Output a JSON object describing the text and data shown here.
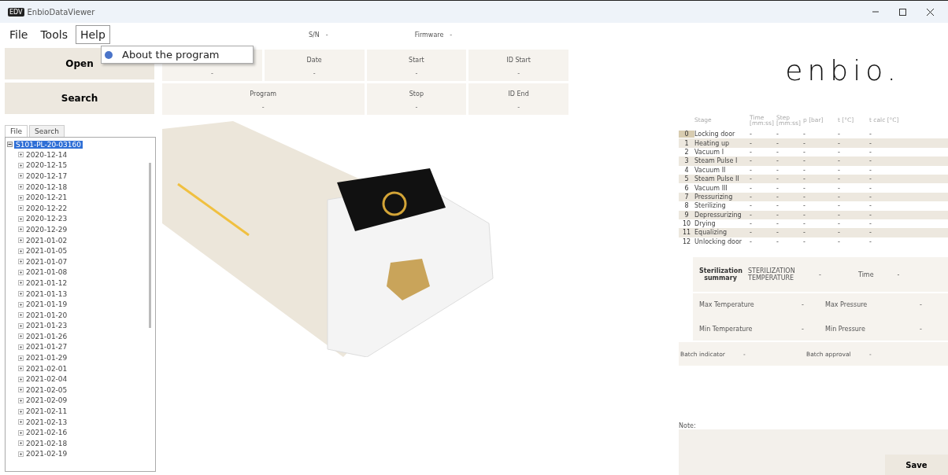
{
  "window": {
    "title": "EnbioDataViewer",
    "app_badge": "EDV"
  },
  "menu": [
    {
      "label": "File",
      "selected": false
    },
    {
      "label": "Tools",
      "selected": false
    },
    {
      "label": "Help",
      "selected": true
    }
  ],
  "dropdown": {
    "items": [
      "About the program"
    ]
  },
  "header_fields": [
    {
      "label": "S/N",
      "value": "-"
    },
    {
      "label": "Firmware",
      "value": "-"
    }
  ],
  "actions": [
    "Open",
    "Search"
  ],
  "info_top": [
    {
      "value": "-"
    },
    {
      "label": "Date",
      "value": "-"
    },
    {
      "label": "Start",
      "value": "-"
    },
    {
      "label": "ID Start",
      "value": "-"
    }
  ],
  "info_bottom": [
    {
      "label": "Program",
      "value": "-"
    },
    {
      "label": "Stop",
      "value": "-"
    },
    {
      "label": "ID End",
      "value": "-"
    }
  ],
  "side_tabs": [
    {
      "label": "File",
      "selected": true
    },
    {
      "label": "Search",
      "selected": false
    }
  ],
  "tree": {
    "label": "S101-PL-20-03160",
    "expanded": true,
    "selected": true,
    "children": [
      {
        "label": "2020-12-14"
      },
      {
        "label": "2020-12-15"
      },
      {
        "label": "2020-12-17"
      },
      {
        "label": "2020-12-18"
      },
      {
        "label": "2020-12-21"
      },
      {
        "label": "2020-12-22"
      },
      {
        "label": "2020-12-23"
      },
      {
        "label": "2020-12-29"
      },
      {
        "label": "2021-01-02"
      },
      {
        "label": "2021-01-05"
      },
      {
        "label": "2021-01-07"
      },
      {
        "label": "2021-01-08"
      },
      {
        "label": "2021-01-12"
      },
      {
        "label": "2021-01-13"
      },
      {
        "label": "2021-01-19"
      },
      {
        "label": "2021-01-20"
      },
      {
        "label": "2021-01-23"
      },
      {
        "label": "2021-01-26"
      },
      {
        "label": "2021-01-27"
      },
      {
        "label": "2021-01-29"
      },
      {
        "label": "2021-02-01"
      },
      {
        "label": "2021-02-04"
      },
      {
        "label": "2021-02-05"
      },
      {
        "label": "2021-02-09"
      },
      {
        "label": "2021-02-11"
      },
      {
        "label": "2021-02-13"
      },
      {
        "label": "2021-02-16"
      },
      {
        "label": "2021-02-18"
      },
      {
        "label": "2021-02-19"
      }
    ]
  },
  "logo": "enbio.",
  "stages": {
    "columns": [
      "",
      "Stage",
      "Time [mm:ss]",
      "Step [mm:ss]",
      "p [bar]",
      "t [°C]",
      "t calc [°C]"
    ],
    "rows": [
      {
        "selected": true,
        "cells": [
          "0",
          "Locking door",
          "-",
          "-",
          "-",
          "-",
          "-"
        ]
      },
      {
        "selected": false,
        "cells": [
          "1",
          "Heating up",
          "-",
          "-",
          "-",
          "-",
          "-"
        ]
      },
      {
        "selected": false,
        "cells": [
          "2",
          "Vacuum I",
          "-",
          "-",
          "-",
          "-",
          "-"
        ]
      },
      {
        "selected": false,
        "cells": [
          "3",
          "Steam Pulse I",
          "-",
          "-",
          "-",
          "-",
          "-"
        ]
      },
      {
        "selected": false,
        "cells": [
          "4",
          "Vacuum II",
          "-",
          "-",
          "-",
          "-",
          "-"
        ]
      },
      {
        "selected": false,
        "cells": [
          "5",
          "Steam Pulse II",
          "-",
          "-",
          "-",
          "-",
          "-"
        ]
      },
      {
        "selected": false,
        "cells": [
          "6",
          "Vacuum III",
          "-",
          "-",
          "-",
          "-",
          "-"
        ]
      },
      {
        "selected": false,
        "cells": [
          "7",
          "Pressurizing",
          "-",
          "-",
          "-",
          "-",
          "-"
        ]
      },
      {
        "selected": false,
        "cells": [
          "8",
          "Sterilizing",
          "-",
          "-",
          "-",
          "-",
          "-"
        ]
      },
      {
        "selected": false,
        "cells": [
          "9",
          "Depressurizing",
          "-",
          "-",
          "-",
          "-",
          "-"
        ]
      },
      {
        "selected": false,
        "cells": [
          "10",
          "Drying",
          "-",
          "-",
          "-",
          "-",
          "-"
        ]
      },
      {
        "selected": false,
        "cells": [
          "11",
          "Equalizing",
          "-",
          "-",
          "-",
          "-",
          "-"
        ]
      },
      {
        "selected": false,
        "cells": [
          "12",
          "Unlocking door",
          "-",
          "-",
          "-",
          "-",
          "-"
        ]
      }
    ]
  },
  "summary": {
    "title": "Sterilization summary",
    "temp_label": "STERILIZATION TEMPERATURE",
    "temp_value": "-",
    "time_label": "Time",
    "time_value": "-",
    "stats": [
      {
        "label": "Max Temperature",
        "value": "-"
      },
      {
        "label": "Max Pressure",
        "value": "-"
      },
      {
        "label": "Min Temperature",
        "value": "-"
      },
      {
        "label": "Min Pressure",
        "value": "-"
      }
    ],
    "batch": [
      {
        "label": "Batch indicator",
        "value": "-"
      },
      {
        "label": "Batch approval",
        "value": "-"
      }
    ]
  },
  "note": {
    "label": "Note:"
  },
  "save": "Save"
}
